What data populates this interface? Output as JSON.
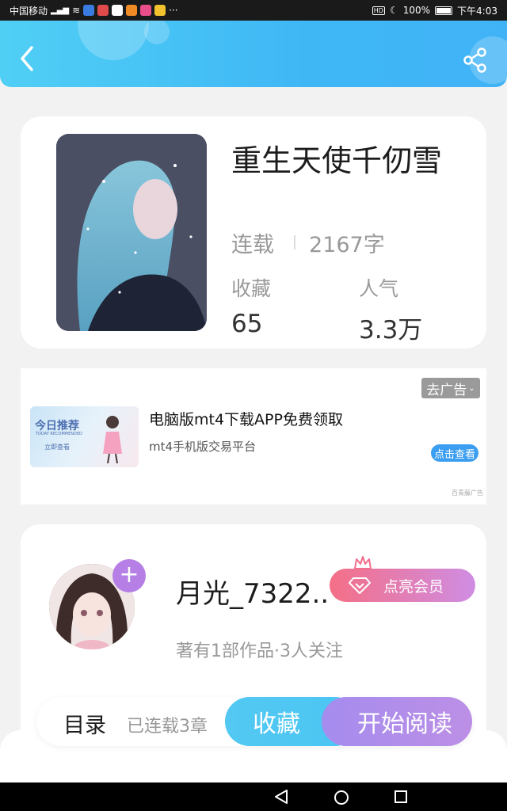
{
  "status_bar": {
    "carrier": "中国移动",
    "battery": "100%",
    "time": "下午4:03",
    "hd_label": "HD",
    "more": "···"
  },
  "book": {
    "title": "重生天使千仞雪",
    "status": "连载",
    "word_count": "2167字",
    "favorites_label": "收藏",
    "favorites_value": "65",
    "popularity_label": "人气",
    "popularity_value": "3.3万"
  },
  "ad": {
    "close_label": "去广告",
    "image_title": "今日推荐",
    "image_subtitle": "TODAY RECOMMENDED",
    "image_button": "立即查看",
    "headline": "电脑版mt4下载APP免费领取",
    "subtext": "mt4手机版交易平台",
    "cta": "点击查看",
    "source": "百青藤广告"
  },
  "author": {
    "name": "月光_7322..",
    "vip_label": "点亮会员",
    "info": "著有1部作品·3人关注"
  },
  "actions": {
    "toc_label": "目录",
    "chapters_label": "已连载3章",
    "collect_label": "收藏",
    "read_label": "开始阅读"
  },
  "colors": {
    "header": "#45c0f5",
    "read_button": "#b08ee9",
    "collect_button": "#4fc7f3",
    "vip_start": "#f46f86",
    "vip_end": "#cf8de3"
  },
  "icons": {
    "back": "back-arrow-icon",
    "share": "share-icon",
    "plus": "plus-icon",
    "gem": "diamond-icon",
    "crown": "crown-icon"
  }
}
